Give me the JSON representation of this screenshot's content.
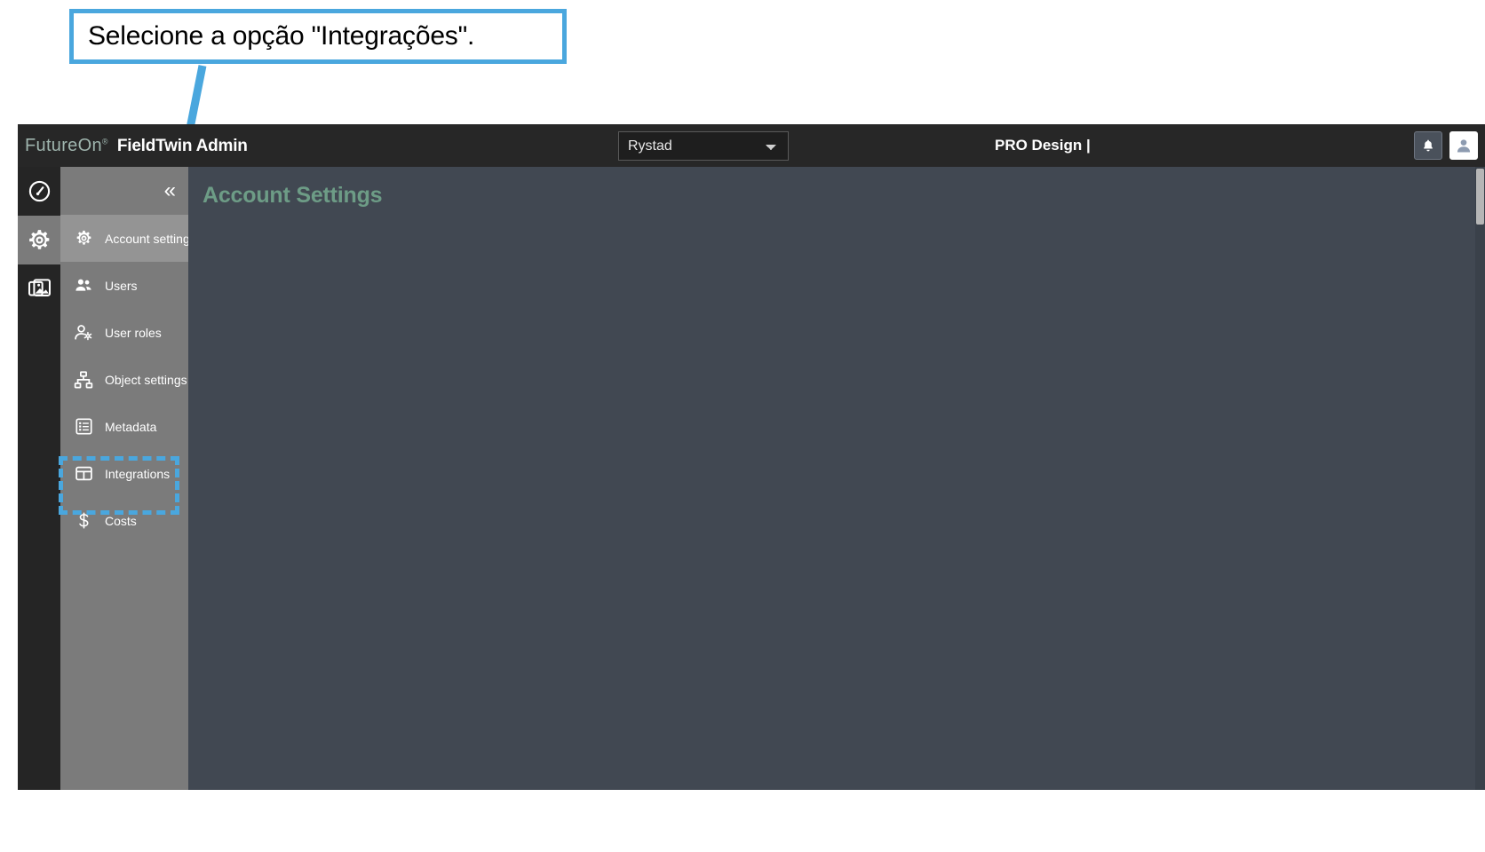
{
  "annotation": {
    "callout_text": "Selecione a opção \"Integrações\".",
    "accent_color": "#4aa7de",
    "arrow_name": "pointer-arrow"
  },
  "header": {
    "logo_text": "FutureOn",
    "logo_mark": "®",
    "app_title": "FieldTwin Admin",
    "account_selector": {
      "value": "Rystad",
      "options": [
        "Rystad"
      ]
    },
    "project_label": "PRO Design |",
    "actions": [
      {
        "name": "notifications-button",
        "icon": "bell-icon"
      },
      {
        "name": "user-avatar-button",
        "icon": "user-avatar-icon"
      }
    ]
  },
  "rail": {
    "items": [
      {
        "label": "Dashboard",
        "icon": "gauge-icon",
        "active": false
      },
      {
        "label": "Settings",
        "icon": "gear-icon",
        "active": true
      },
      {
        "label": "Gallery",
        "icon": "images-icon",
        "active": false
      }
    ]
  },
  "sidebar": {
    "collapse_label": "«",
    "items": [
      {
        "label": "Account settings",
        "icon": "gear-icon",
        "active": true
      },
      {
        "label": "Users",
        "icon": "users-icon",
        "active": false
      },
      {
        "label": "User roles",
        "icon": "user-gear-icon",
        "active": false
      },
      {
        "label": "Object settings",
        "icon": "sitemap-icon",
        "active": false
      },
      {
        "label": "Metadata",
        "icon": "list-icon",
        "active": false
      },
      {
        "label": "Integrations",
        "icon": "table-icon",
        "active": false
      },
      {
        "label": "Costs",
        "icon": "dollar-icon",
        "active": false
      }
    ]
  },
  "main": {
    "page_title": "Account Settings",
    "title_color": "#6d9c86",
    "background_color": "#414852"
  }
}
